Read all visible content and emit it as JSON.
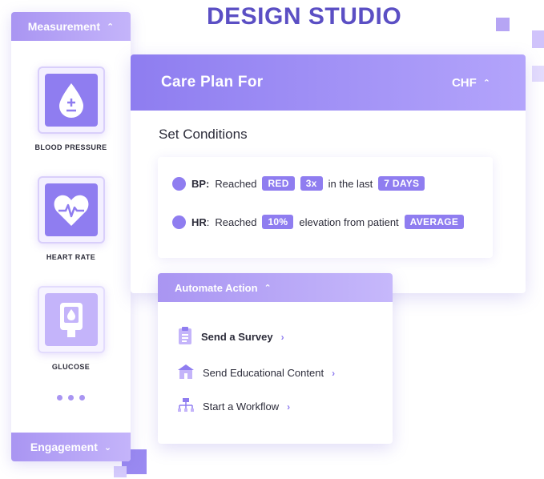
{
  "brand": {
    "title": "DESIGN STUDIO"
  },
  "sidebar": {
    "header_label": "Measurement",
    "footer_label": "Engagement",
    "items": [
      {
        "label": "BLOOD PRESSURE",
        "icon": "blood-drop-icon"
      },
      {
        "label": "HEART RATE",
        "icon": "heart-pulse-icon"
      },
      {
        "label": "GLUCOSE",
        "icon": "glucose-meter-icon"
      }
    ],
    "more_icon": "more-dots-icon"
  },
  "care_plan": {
    "title": "Care Plan For",
    "condition_code": "CHF",
    "subtitle": "Set Conditions",
    "conditions": [
      {
        "key": "BP:",
        "text_1": "Reached",
        "pill_1": "RED",
        "pill_2": "3x",
        "text_2": "in the last",
        "pill_3": "7 DAYS"
      },
      {
        "key": "HR",
        "sep": ":",
        "text_1": "Reached",
        "pill_1": "10%",
        "text_2": "elevation from patient",
        "pill_2": "AVERAGE"
      }
    ]
  },
  "automate": {
    "header_label": "Automate Action",
    "actions": [
      {
        "label": "Send a Survey",
        "icon": "survey-clipboard-icon"
      },
      {
        "label": "Send Educational Content",
        "icon": "school-building-icon"
      },
      {
        "label": "Start a Workflow",
        "icon": "workflow-tree-icon"
      }
    ]
  },
  "colors": {
    "accent": "#8f7df0",
    "accent_light": "#c4b4fa",
    "brand": "#5b4fc4"
  }
}
